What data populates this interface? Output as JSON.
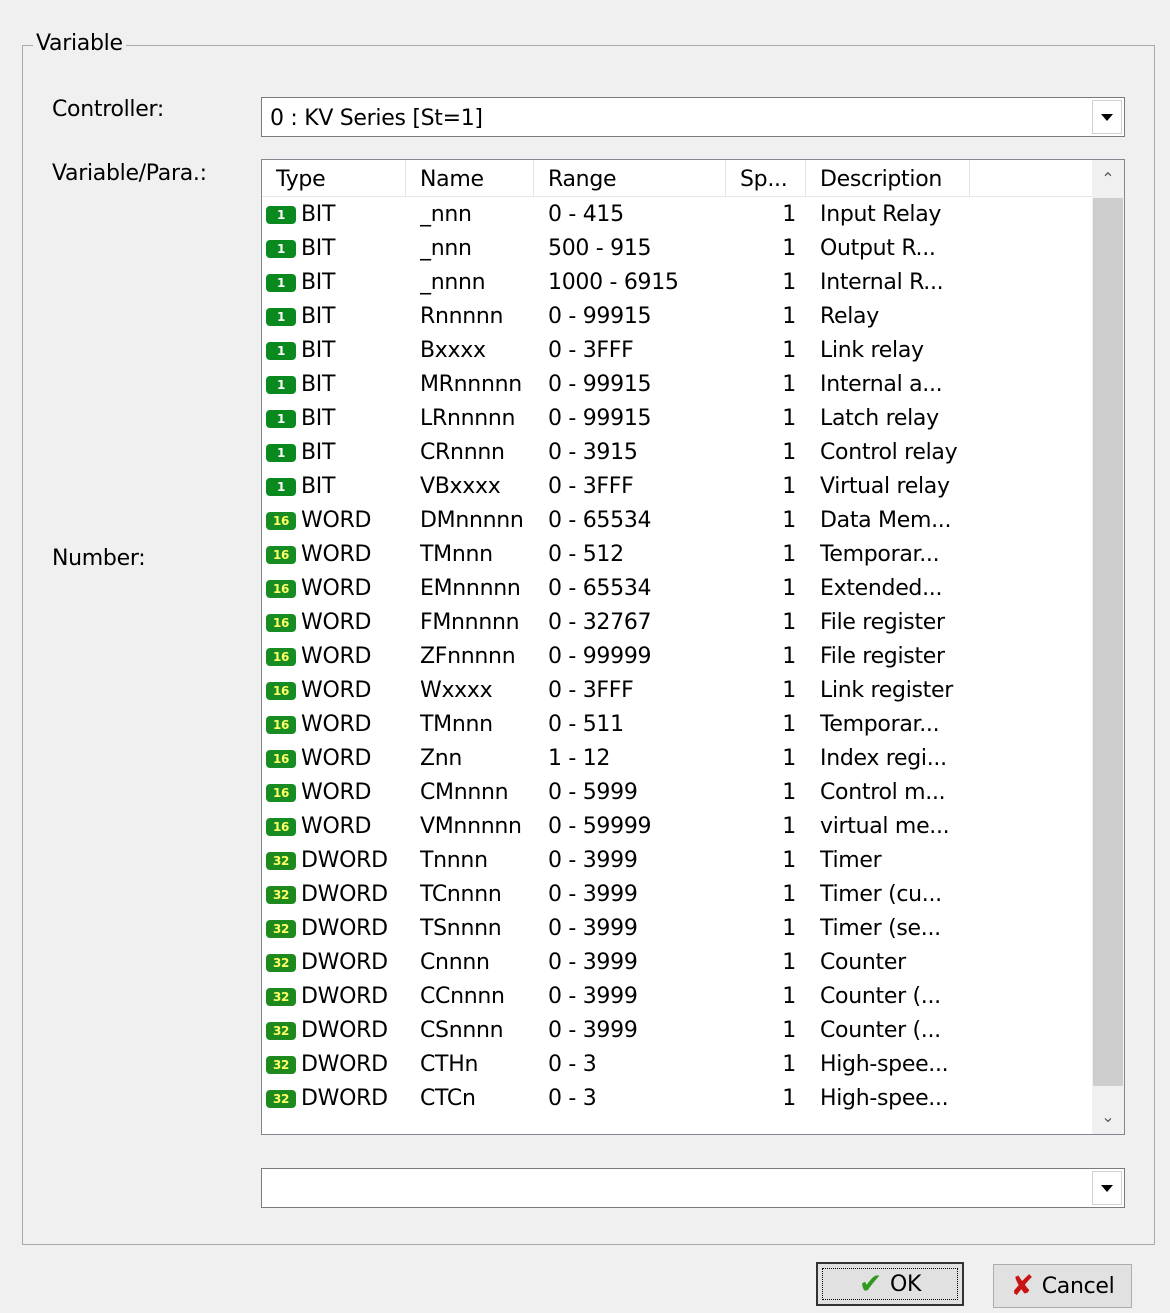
{
  "group_title": "Variable",
  "labels": {
    "controller": "Controller:",
    "variable": "Variable/Para.:",
    "number": "Number:"
  },
  "controller_combo": {
    "value": "0 : KV Series [St=1]",
    "icon": "chevron-down-icon"
  },
  "number_combo": {
    "value": "",
    "icon": "chevron-down-icon"
  },
  "list": {
    "columns": [
      "Type",
      "Name",
      "Range",
      "Sp...",
      "Description"
    ],
    "rows": [
      {
        "badge": "1",
        "type": "BIT",
        "name": "_nnn",
        "range": "0 - 415",
        "sp": "1",
        "desc": "Input Relay"
      },
      {
        "badge": "1",
        "type": "BIT",
        "name": "_nnn",
        "range": "500 - 915",
        "sp": "1",
        "desc": "Output R..."
      },
      {
        "badge": "1",
        "type": "BIT",
        "name": "_nnnn",
        "range": "1000 - 6915",
        "sp": "1",
        "desc": "Internal R..."
      },
      {
        "badge": "1",
        "type": "BIT",
        "name": "Rnnnnn",
        "range": "0 - 99915",
        "sp": "1",
        "desc": "Relay"
      },
      {
        "badge": "1",
        "type": "BIT",
        "name": "Bxxxx",
        "range": "0 - 3FFF",
        "sp": "1",
        "desc": "Link relay"
      },
      {
        "badge": "1",
        "type": "BIT",
        "name": "MRnnnnn",
        "range": "0 - 99915",
        "sp": "1",
        "desc": "Internal a..."
      },
      {
        "badge": "1",
        "type": "BIT",
        "name": "LRnnnnn",
        "range": "0 - 99915",
        "sp": "1",
        "desc": "Latch relay"
      },
      {
        "badge": "1",
        "type": "BIT",
        "name": "CRnnnn",
        "range": "0 - 3915",
        "sp": "1",
        "desc": "Control relay"
      },
      {
        "badge": "1",
        "type": "BIT",
        "name": "VBxxxx",
        "range": "0 - 3FFF",
        "sp": "1",
        "desc": "Virtual relay"
      },
      {
        "badge": "16",
        "type": "WORD",
        "name": "DMnnnnn",
        "range": "0 - 65534",
        "sp": "1",
        "desc": "Data Mem..."
      },
      {
        "badge": "16",
        "type": "WORD",
        "name": "TMnnn",
        "range": "0 - 512",
        "sp": "1",
        "desc": "Temporar..."
      },
      {
        "badge": "16",
        "type": "WORD",
        "name": "EMnnnnn",
        "range": "0 - 65534",
        "sp": "1",
        "desc": "Extended..."
      },
      {
        "badge": "16",
        "type": "WORD",
        "name": "FMnnnnn",
        "range": "0 - 32767",
        "sp": "1",
        "desc": "File register"
      },
      {
        "badge": "16",
        "type": "WORD",
        "name": "ZFnnnnn",
        "range": "0 - 99999",
        "sp": "1",
        "desc": "File register"
      },
      {
        "badge": "16",
        "type": "WORD",
        "name": "Wxxxx",
        "range": "0 - 3FFF",
        "sp": "1",
        "desc": "Link register"
      },
      {
        "badge": "16",
        "type": "WORD",
        "name": "TMnnn",
        "range": "0 - 511",
        "sp": "1",
        "desc": "Temporar..."
      },
      {
        "badge": "16",
        "type": "WORD",
        "name": "Znn",
        "range": "1 - 12",
        "sp": "1",
        "desc": "Index regi..."
      },
      {
        "badge": "16",
        "type": "WORD",
        "name": "CMnnnn",
        "range": "0 - 5999",
        "sp": "1",
        "desc": "Control m..."
      },
      {
        "badge": "16",
        "type": "WORD",
        "name": "VMnnnnn",
        "range": "0 - 59999",
        "sp": "1",
        "desc": "virtual me..."
      },
      {
        "badge": "32",
        "type": "DWORD",
        "name": "Tnnnn",
        "range": "0 - 3999",
        "sp": "1",
        "desc": "Timer"
      },
      {
        "badge": "32",
        "type": "DWORD",
        "name": "TCnnnn",
        "range": "0 - 3999",
        "sp": "1",
        "desc": "Timer (cu..."
      },
      {
        "badge": "32",
        "type": "DWORD",
        "name": "TSnnnn",
        "range": "0 - 3999",
        "sp": "1",
        "desc": "Timer (se..."
      },
      {
        "badge": "32",
        "type": "DWORD",
        "name": "Cnnnn",
        "range": "0 - 3999",
        "sp": "1",
        "desc": "Counter"
      },
      {
        "badge": "32",
        "type": "DWORD",
        "name": "CCnnnn",
        "range": "0 - 3999",
        "sp": "1",
        "desc": "Counter (..."
      },
      {
        "badge": "32",
        "type": "DWORD",
        "name": "CSnnnn",
        "range": "0 - 3999",
        "sp": "1",
        "desc": "Counter (..."
      },
      {
        "badge": "32",
        "type": "DWORD",
        "name": "CTHn",
        "range": "0 - 3",
        "sp": "1",
        "desc": "High-spee..."
      },
      {
        "badge": "32",
        "type": "DWORD",
        "name": "CTCn",
        "range": "0 - 3",
        "sp": "1",
        "desc": "High-spee..."
      }
    ]
  },
  "buttons": {
    "ok": {
      "label": "OK",
      "icon": "checkmark-icon"
    },
    "cancel": {
      "label": "Cancel",
      "icon": "x-icon"
    }
  }
}
